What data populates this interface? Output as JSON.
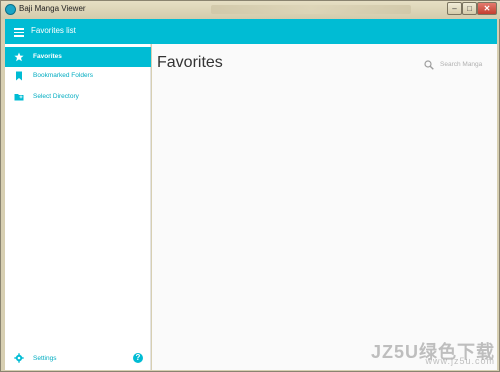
{
  "window": {
    "title": "Baji Manga Viewer",
    "controls": [
      "minimize-icon",
      "maximize-icon",
      "close-icon"
    ]
  },
  "appbar": {
    "title": "Favorites list",
    "menu_icon": "menu-icon"
  },
  "sidebar": {
    "items": [
      {
        "label": "Favorites",
        "icon": "star-icon",
        "active": true
      },
      {
        "label": "Bookmarked Folders",
        "icon": "bookmark-icon",
        "active": false
      },
      {
        "label": "Select Directory",
        "icon": "folder-icon",
        "active": false
      }
    ],
    "settings_label": "Settings",
    "help_symbol": "?"
  },
  "main": {
    "title": "Favorites",
    "search_placeholder": "Search Manga"
  },
  "watermark": {
    "main": "JZ5U绿色下载",
    "url": "www.jz5u.com"
  },
  "colors": {
    "accent": "#00bcd4",
    "main_bg": "#fafafa",
    "sidebar_bg": "#ffffff"
  }
}
